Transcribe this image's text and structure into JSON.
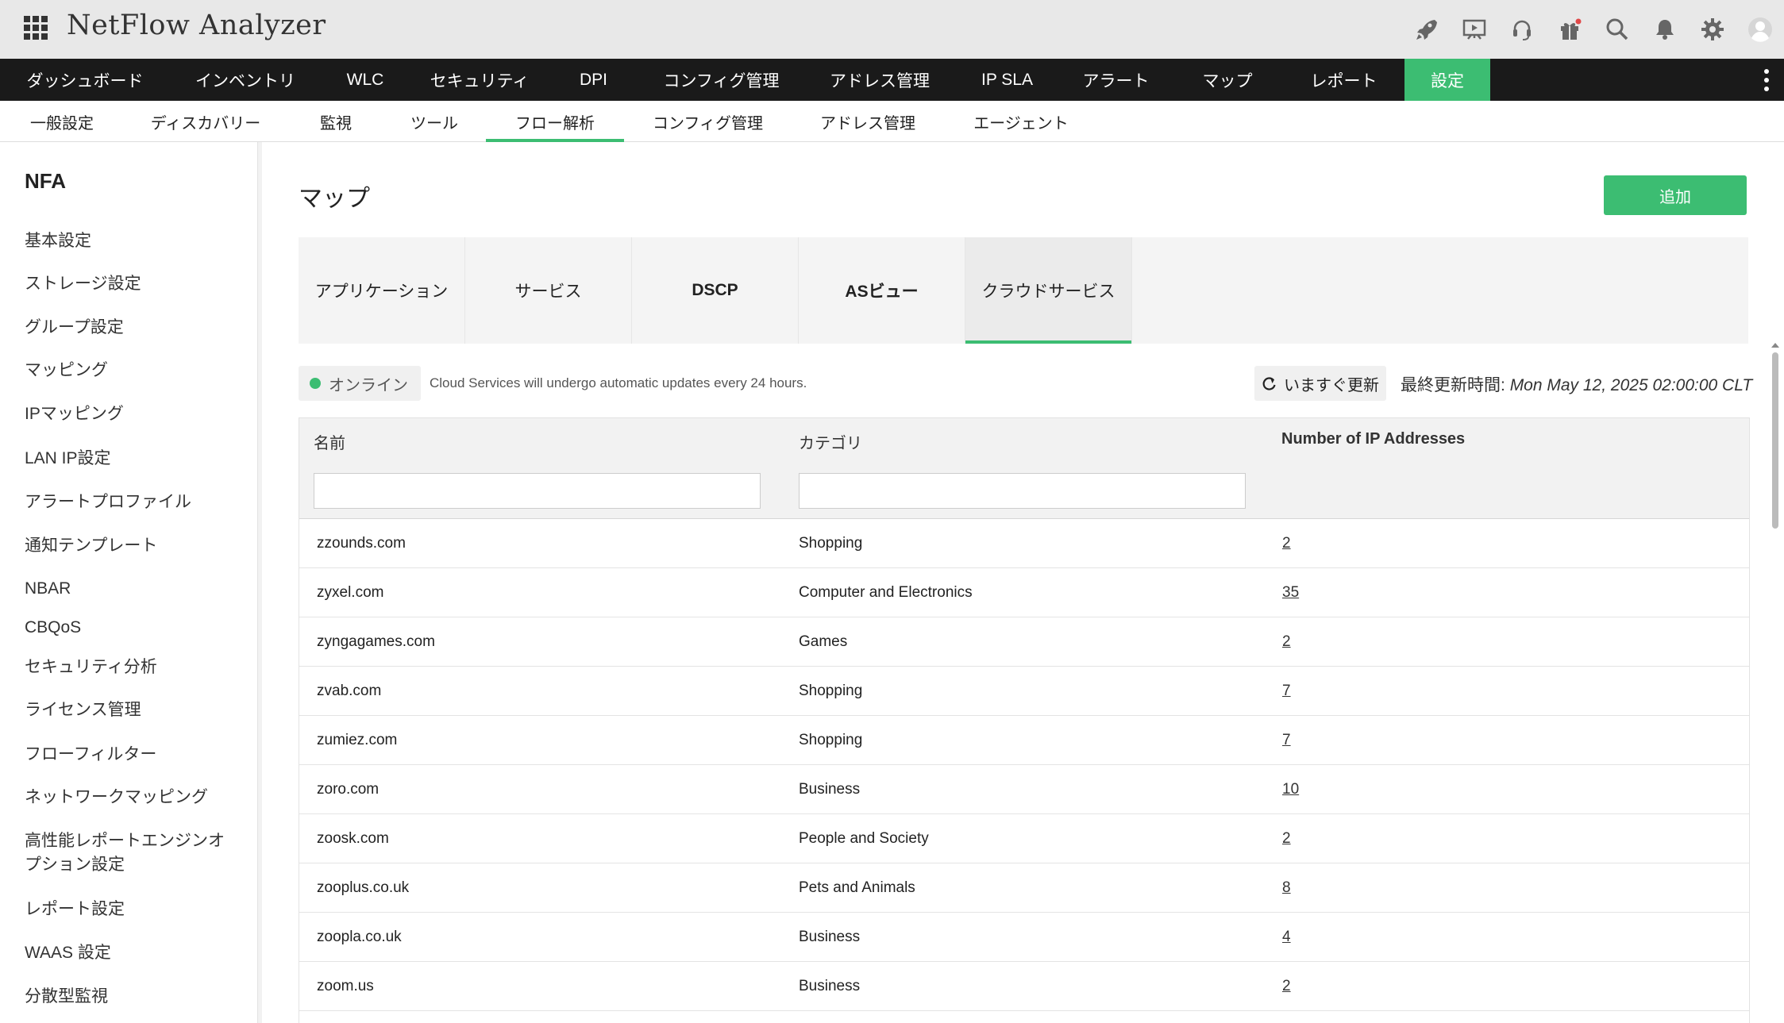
{
  "app": {
    "title": "NetFlow Analyzer",
    "accent": "#3cbd72",
    "header_icons": [
      "rocket-icon",
      "presentation-icon",
      "headset-icon",
      "gift-icon",
      "search-icon",
      "bell-icon",
      "gear-icon",
      "user-avatar-icon"
    ]
  },
  "main_nav": {
    "items": [
      {
        "label": "ダッシュボード",
        "active": false
      },
      {
        "label": "インベントリ",
        "active": false
      },
      {
        "label": "WLC",
        "active": false
      },
      {
        "label": "セキュリティ",
        "active": false
      },
      {
        "label": "DPI",
        "active": false
      },
      {
        "label": "コンフィグ管理",
        "active": false
      },
      {
        "label": "アドレス管理",
        "active": false
      },
      {
        "label": "IP SLA",
        "active": false
      },
      {
        "label": "アラート",
        "active": false
      },
      {
        "label": "マップ",
        "active": false
      },
      {
        "label": "レポート",
        "active": false
      },
      {
        "label": "設定",
        "active": true
      }
    ]
  },
  "sub_nav": {
    "items": [
      {
        "label": "一般設定",
        "active": false
      },
      {
        "label": "ディスカバリー",
        "active": false
      },
      {
        "label": "監視",
        "active": false
      },
      {
        "label": "ツール",
        "active": false
      },
      {
        "label": "フロー解析",
        "active": true
      },
      {
        "label": "コンフィグ管理",
        "active": false
      },
      {
        "label": "アドレス管理",
        "active": false
      },
      {
        "label": "エージェント",
        "active": false
      }
    ]
  },
  "sidebar": {
    "title": "NFA",
    "items": [
      {
        "label": "基本設定"
      },
      {
        "label": "ストレージ設定"
      },
      {
        "label": "グループ設定"
      },
      {
        "label": "マッピング"
      },
      {
        "label": "IPマッピング"
      },
      {
        "label": "LAN IP設定"
      },
      {
        "label": "アラートプロファイル"
      },
      {
        "label": "通知テンプレート"
      },
      {
        "label": "NBAR"
      },
      {
        "label": "CBQoS"
      },
      {
        "label": "セキュリティ分析"
      },
      {
        "label": "ライセンス管理"
      },
      {
        "label": "フローフィルター"
      },
      {
        "label": "ネットワークマッピング"
      },
      {
        "label": "高性能レポートエンジンオプション設定"
      },
      {
        "label": "レポート設定"
      },
      {
        "label": "WAAS 設定"
      },
      {
        "label": "分散型監視"
      }
    ]
  },
  "page": {
    "title": "マップ",
    "add_label": "追加",
    "tabs": [
      {
        "label": "アプリケーション",
        "active": false
      },
      {
        "label": "サービス",
        "active": false
      },
      {
        "label": "DSCP",
        "active": false
      },
      {
        "label": "ASビュー",
        "active": false
      },
      {
        "label": "クラウドサービス",
        "active": true
      }
    ],
    "status": {
      "label": "オンライン",
      "color": "#3cbd72",
      "note": "Cloud Services will undergo automatic updates every 24 hours."
    },
    "refresh_label": "いますぐ更新",
    "last_updated_label": "最終更新時間:",
    "last_updated_value": "Mon May 12, 2025 02:00:00 CLT"
  },
  "table": {
    "columns": [
      "名前",
      "カテゴリ",
      "Number of IP Addresses"
    ],
    "filters": {
      "name": "",
      "category": ""
    },
    "rows": [
      {
        "name": "zzounds.com",
        "category": "Shopping",
        "ip_count": "2"
      },
      {
        "name": "zyxel.com",
        "category": "Computer and Electronics",
        "ip_count": "35"
      },
      {
        "name": "zyngagames.com",
        "category": "Games",
        "ip_count": "2"
      },
      {
        "name": "zvab.com",
        "category": "Shopping",
        "ip_count": "7"
      },
      {
        "name": "zumiez.com",
        "category": "Shopping",
        "ip_count": "7"
      },
      {
        "name": "zoro.com",
        "category": "Business",
        "ip_count": "10"
      },
      {
        "name": "zoosk.com",
        "category": "People and Society",
        "ip_count": "2"
      },
      {
        "name": "zooplus.co.uk",
        "category": "Pets and Animals",
        "ip_count": "8"
      },
      {
        "name": "zoopla.co.uk",
        "category": "Business",
        "ip_count": "4"
      },
      {
        "name": "zoom.us",
        "category": "Business",
        "ip_count": "2"
      }
    ]
  }
}
